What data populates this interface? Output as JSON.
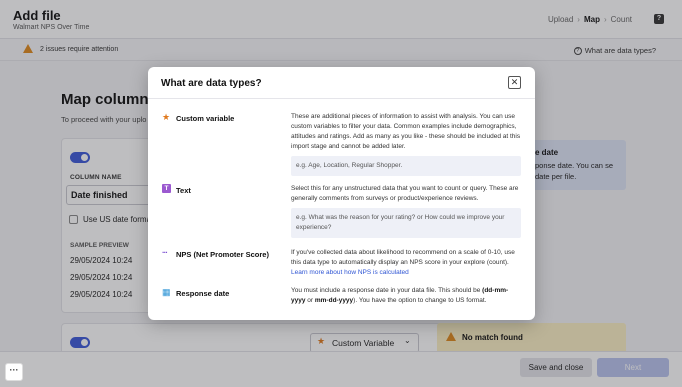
{
  "header": {
    "title": "Add file",
    "subtitle": "Walmart NPS Over Time",
    "steps": [
      "Upload",
      "Map",
      "Count"
    ],
    "active_step": "Map",
    "step_sep": "›",
    "help_label": "?"
  },
  "warning": {
    "text": "2 issues require attention",
    "link": "What are data types?",
    "link_icon": "?"
  },
  "main": {
    "heading": "Map columns",
    "subheading": "To proceed with your uplo",
    "column_name_label": "COLUMN NAME",
    "column_name_value": "Date finished",
    "checkbox_label": "Use US date forma",
    "sample_preview_label": "SAMPLE PREVIEW",
    "samples": [
      "29/05/2024 10:24",
      "29/05/2024 10:24",
      "29/05/2024 10:24"
    ],
    "info_title": "e date",
    "info_text": "ponse date. You can se date per file.",
    "variable_select": "Custom Variable",
    "variable_chevron": "⌄",
    "no_match_title": "No match found"
  },
  "footer": {
    "menu_label": "···",
    "save_close": "Save and close",
    "next": "Next"
  },
  "modal": {
    "title": "What are data types?",
    "close_label": "✕",
    "types": [
      {
        "name": "Custom variable",
        "icon": "star-icon",
        "glyph": "★",
        "desc": "These are additional pieces of information to assist with analysis. You can use custom variables to filter your data. Common examples include demographics, attitudes and ratings. Add as many as you like - these should be included at this import stage and cannot be added later.",
        "example": "e.g. Age, Location, Regular Shopper."
      },
      {
        "name": "Text",
        "icon": "text-icon",
        "glyph": "T",
        "desc": "Select this for any unstructured data that you want to count or query. These are generally comments from surveys or product/experience reviews.",
        "example": "e.g. What was the reason for your rating? or How could we improve your experience?"
      },
      {
        "name": "NPS (Net Promoter Score)",
        "icon": "nps-icon",
        "glyph": "···",
        "desc": "If you've collected data about likelihood to recommend on a scale of 0-10, use this data type to automatically display an NPS score in your explore (count).",
        "link": "Learn more about how NPS is calculated"
      },
      {
        "name": "Response date",
        "icon": "calendar-icon",
        "glyph": "▦",
        "desc_pre": "You must include a response date in your data file. This should be",
        "fmt1": "(dd-mm-yyyy",
        "desc_mid": " or ",
        "fmt2": "mm-dd-yyyy",
        "desc_post": "). You have the option to change to US format."
      }
    ]
  },
  "colors": {
    "accent": "#3d5ad8",
    "custom_variable": "#e07a1f",
    "text_type": "#9b59d0",
    "nps": "#7a4fd1",
    "response_date": "#2a93d5",
    "warning": "#e08a1e"
  }
}
